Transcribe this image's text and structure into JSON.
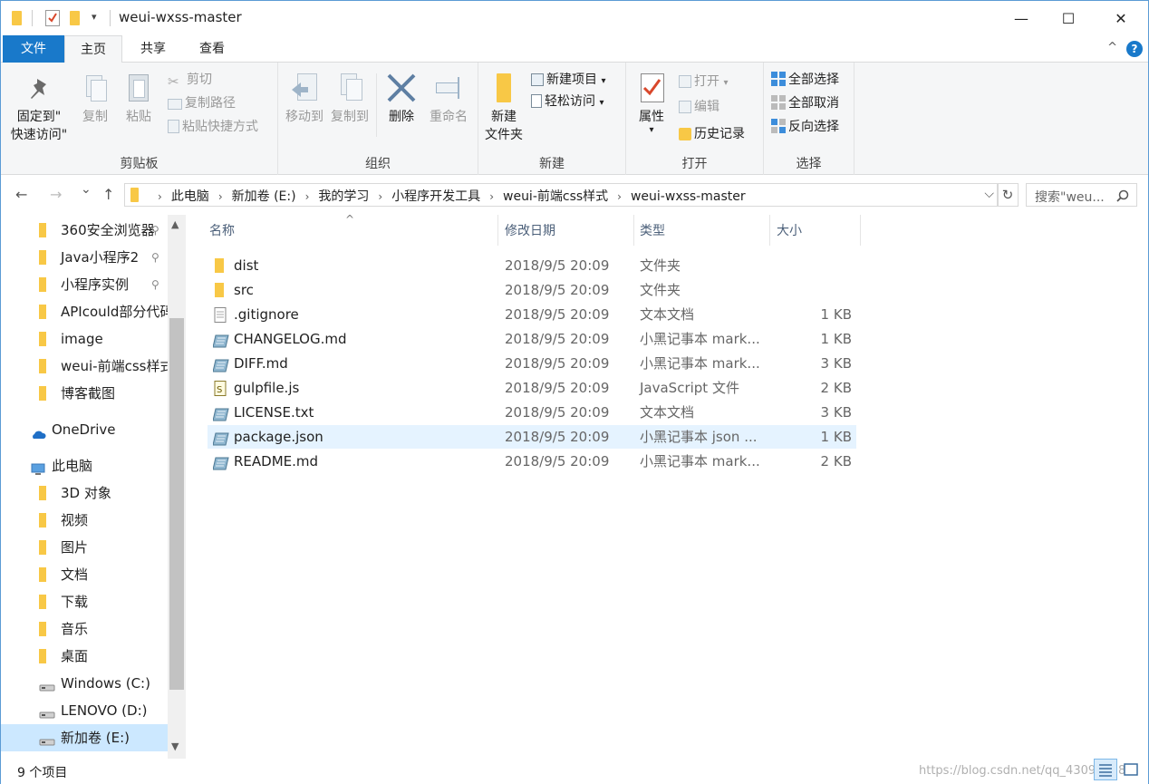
{
  "window": {
    "title": "weui-wxss-master",
    "minimize": "—",
    "maximize": "☐",
    "close": "✕"
  },
  "ribbon_tabs": [
    "文件",
    "主页",
    "共享",
    "查看"
  ],
  "help": "?",
  "collapse": "^",
  "ribbon": {
    "clipboard": {
      "label": "剪贴板",
      "pin": "固定到\"\n快速访问\"",
      "pin_line1": "固定到\"",
      "pin_line2": "快速访问\"",
      "copy": "复制",
      "paste": "粘贴",
      "cut": "剪切",
      "copy_path": "复制路径",
      "paste_shortcut": "粘贴快捷方式"
    },
    "organize": {
      "label": "组织",
      "move_to": "移动到",
      "copy_to": "复制到",
      "delete": "删除",
      "rename": "重命名"
    },
    "new": {
      "label": "新建",
      "new_folder_line1": "新建",
      "new_folder_line2": "文件夹",
      "new_item": "新建项目",
      "easy_access": "轻松访问"
    },
    "open": {
      "label": "打开",
      "properties": "属性",
      "open": "打开",
      "edit": "编辑",
      "history": "历史记录"
    },
    "select": {
      "label": "选择",
      "select_all": "全部选择",
      "select_none": "全部取消",
      "invert": "反向选择"
    }
  },
  "address": {
    "crumbs": [
      "此电脑",
      "新加卷 (E:)",
      "我的学习",
      "小程序开发工具",
      "weui-前端css样式",
      "weui-wxss-master"
    ],
    "search_placeholder": "搜索\"weu...",
    "dropdown": "⌵",
    "refresh": "↻"
  },
  "nav": {
    "back": "←",
    "forward": "→",
    "recent": "⌄",
    "up": "↑"
  },
  "nav_pane": [
    {
      "label": "360安全浏览器",
      "pinned": true,
      "icon": "folder"
    },
    {
      "label": "Java小程序2",
      "pinned": true,
      "icon": "folder"
    },
    {
      "label": "小程序实例",
      "pinned": true,
      "icon": "folder"
    },
    {
      "label": "APIcould部分代码",
      "pinned": false,
      "icon": "folder"
    },
    {
      "label": "image",
      "pinned": false,
      "icon": "folder"
    },
    {
      "label": "weui-前端css样式",
      "pinned": false,
      "icon": "folder"
    },
    {
      "label": "博客截图",
      "pinned": false,
      "icon": "folder"
    },
    {
      "label": "OneDrive",
      "pinned": false,
      "icon": "cloud"
    },
    {
      "label": "此电脑",
      "pinned": false,
      "icon": "pc"
    },
    {
      "label": "3D 对象",
      "pinned": false,
      "icon": "folder"
    },
    {
      "label": "视频",
      "pinned": false,
      "icon": "folder"
    },
    {
      "label": "图片",
      "pinned": false,
      "icon": "folder"
    },
    {
      "label": "文档",
      "pinned": false,
      "icon": "folder"
    },
    {
      "label": "下载",
      "pinned": false,
      "icon": "folder"
    },
    {
      "label": "音乐",
      "pinned": false,
      "icon": "folder"
    },
    {
      "label": "桌面",
      "pinned": false,
      "icon": "folder"
    },
    {
      "label": "Windows (C:)",
      "pinned": false,
      "icon": "drive"
    },
    {
      "label": "LENOVO (D:)",
      "pinned": false,
      "icon": "drive"
    },
    {
      "label": "新加卷 (E:)",
      "pinned": false,
      "icon": "drive"
    }
  ],
  "pin_glyph": "📌",
  "columns": {
    "name": "名称",
    "date": "修改日期",
    "type": "类型",
    "size": "大小",
    "sort_glyph": "^"
  },
  "files": [
    {
      "name": "dist",
      "date": "2018/9/5 20:09",
      "type": "文件夹",
      "size": "",
      "icon": "folder"
    },
    {
      "name": "src",
      "date": "2018/9/5 20:09",
      "type": "文件夹",
      "size": "",
      "icon": "folder"
    },
    {
      "name": ".gitignore",
      "date": "2018/9/5 20:09",
      "type": "文本文档",
      "size": "1 KB",
      "icon": "text"
    },
    {
      "name": "CHANGELOG.md",
      "date": "2018/9/5 20:09",
      "type": "小黑记事本 mark...",
      "size": "1 KB",
      "icon": "notepad"
    },
    {
      "name": "DIFF.md",
      "date": "2018/9/5 20:09",
      "type": "小黑记事本 mark...",
      "size": "3 KB",
      "icon": "notepad"
    },
    {
      "name": "gulpfile.js",
      "date": "2018/9/5 20:09",
      "type": "JavaScript 文件",
      "size": "2 KB",
      "icon": "js"
    },
    {
      "name": "LICENSE.txt",
      "date": "2018/9/5 20:09",
      "type": "文本文档",
      "size": "3 KB",
      "icon": "notepad"
    },
    {
      "name": "package.json",
      "date": "2018/9/5 20:09",
      "type": "小黑记事本 json ...",
      "size": "1 KB",
      "icon": "notepad"
    },
    {
      "name": "README.md",
      "date": "2018/9/5 20:09",
      "type": "小黑记事本 mark...",
      "size": "2 KB",
      "icon": "notepad"
    }
  ],
  "highlighted_row": 7,
  "selected_nav": 18,
  "status": {
    "count": "9 个项目",
    "watermark": "https://blog.csdn.net/qq_43090158"
  },
  "colors": {
    "accent": "#1979ca",
    "folder": "#f8c846",
    "hover": "#e5f3ff",
    "selected": "#cce8ff"
  }
}
